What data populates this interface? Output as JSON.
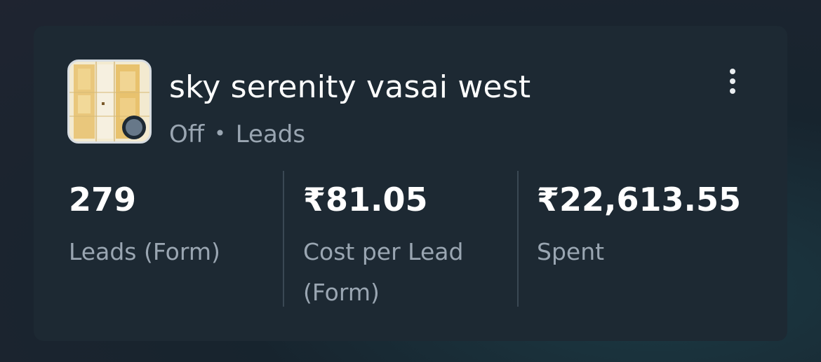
{
  "campaign": {
    "name": "sky serenity vasai west",
    "status": "Off",
    "separator": "•",
    "objective": "Leads",
    "status_color": "#677889",
    "thumbnail_icon": "floor-plan-thumbnail"
  },
  "menu": {
    "icon": "more-vertical-icon"
  },
  "metrics": [
    {
      "value": "279",
      "label_line1": "Leads (Form)",
      "label_line2": ""
    },
    {
      "value": "₹81.05",
      "label_line1": "Cost per Lead",
      "label_line2": "(Form)"
    },
    {
      "value": "₹22,613.55",
      "label_line1": "Spent",
      "label_line2": ""
    }
  ],
  "colors": {
    "card_bg": "#1d2933",
    "muted_text": "#9aa6b2",
    "primary_text": "#ffffff"
  }
}
